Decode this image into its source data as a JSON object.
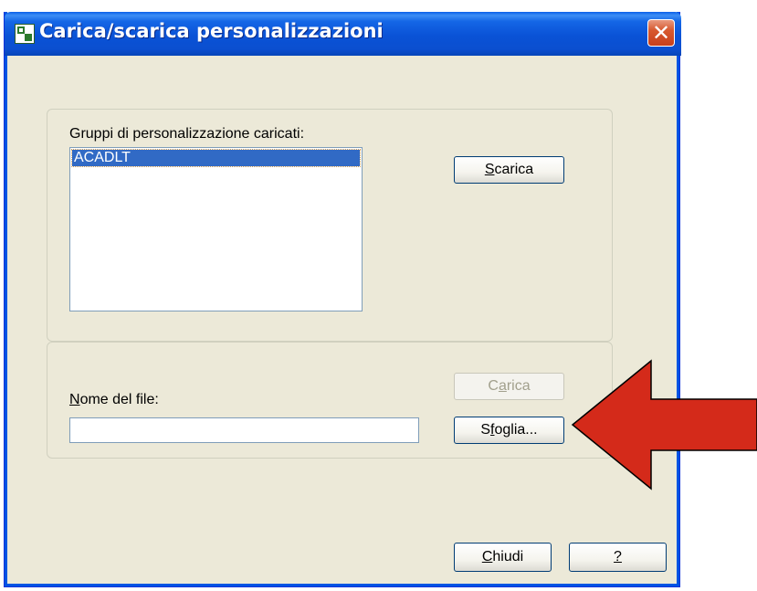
{
  "window": {
    "title": "Carica/scarica personalizzazioni",
    "close_label": "✕"
  },
  "loaded_groups": {
    "label": "Gruppi di personalizzazione caricati:",
    "items": [
      "ACADLT"
    ],
    "selected": "ACADLT",
    "unload_button": {
      "prefix": "",
      "accel": "S",
      "suffix": "carica"
    }
  },
  "load_section": {
    "filename_label": {
      "accel": "N",
      "suffix": "ome del file:"
    },
    "filename_value": "",
    "load_button": {
      "prefix": "C",
      "accel": "a",
      "suffix": "rica",
      "enabled": false
    },
    "browse_button": {
      "prefix": "S",
      "accel": "f",
      "suffix": "oglia..."
    }
  },
  "footer": {
    "close_button": {
      "accel": "C",
      "suffix": "hiudi"
    },
    "help_button": {
      "accel": "?"
    }
  },
  "annotation": {
    "arrow_color": "#d42a1a",
    "pointing_to": "browse-button"
  },
  "colors": {
    "titlebar": "#0a52d6",
    "dialog_bg": "#ece9d8",
    "selection": "#316ac5"
  }
}
